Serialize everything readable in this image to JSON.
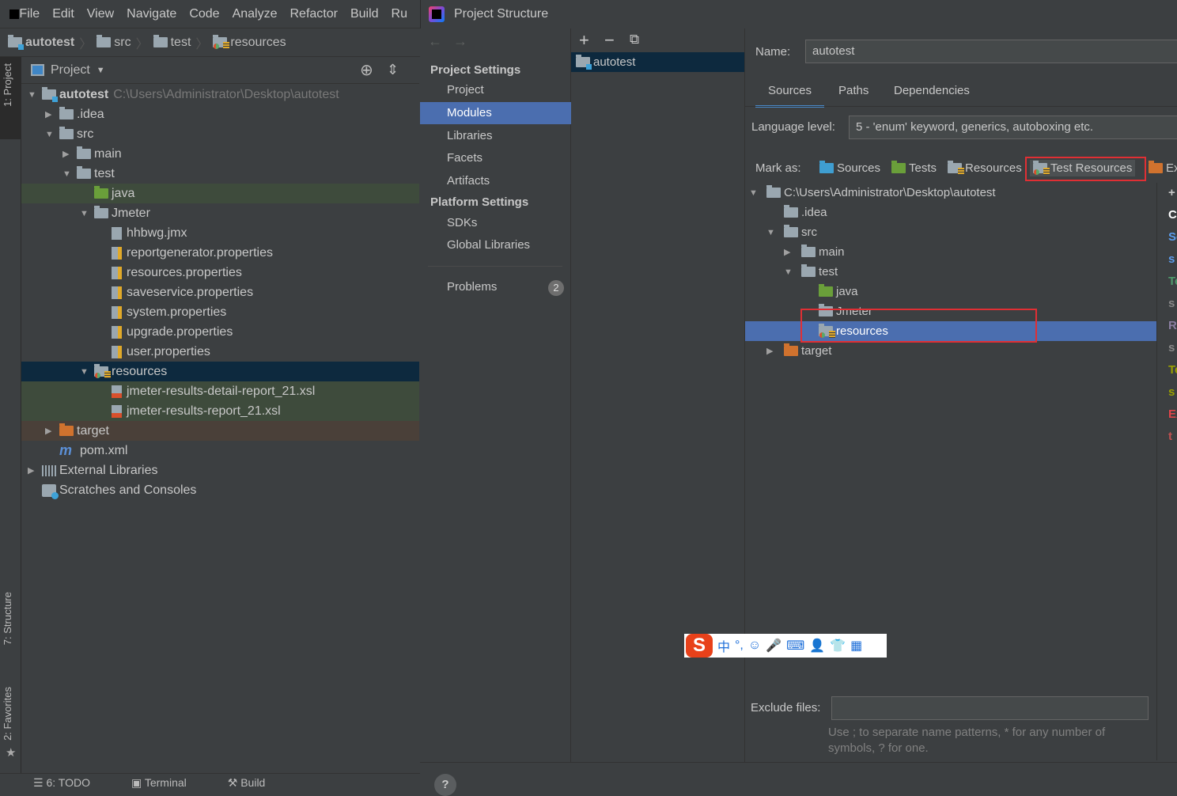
{
  "ide": {
    "menu": [
      "File",
      "Edit",
      "View",
      "Navigate",
      "Code",
      "Analyze",
      "Refactor",
      "Build",
      "Ru"
    ],
    "breadcrumb": [
      "autotest",
      "src",
      "test",
      "resources"
    ],
    "tool_tabs": {
      "project": "1: Project",
      "structure": "7: Structure",
      "favorites": "2: Favorites"
    },
    "project_view": "Project",
    "tree": [
      {
        "label": "autotest",
        "path": "C:\\Users\\Administrator\\Desktop\\autotest",
        "depth": 0,
        "arrow": "down",
        "icon": "folder-module",
        "bold": true
      },
      {
        "label": ".idea",
        "depth": 1,
        "arrow": "right",
        "icon": "folder"
      },
      {
        "label": "src",
        "depth": 1,
        "arrow": "down",
        "icon": "folder"
      },
      {
        "label": "main",
        "depth": 2,
        "arrow": "right",
        "icon": "folder"
      },
      {
        "label": "test",
        "depth": 2,
        "arrow": "down",
        "icon": "folder"
      },
      {
        "label": "java",
        "depth": 3,
        "arrow": "",
        "icon": "folder-green",
        "bg": "#3e4b3c"
      },
      {
        "label": "Jmeter",
        "depth": 3,
        "arrow": "down",
        "icon": "folder"
      },
      {
        "label": "hhbwg.jmx",
        "depth": 4,
        "arrow": "",
        "icon": "file"
      },
      {
        "label": "reportgenerator.properties",
        "depth": 4,
        "arrow": "",
        "icon": "props"
      },
      {
        "label": "resources.properties",
        "depth": 4,
        "arrow": "",
        "icon": "props"
      },
      {
        "label": "saveservice.properties",
        "depth": 4,
        "arrow": "",
        "icon": "props"
      },
      {
        "label": "system.properties",
        "depth": 4,
        "arrow": "",
        "icon": "props"
      },
      {
        "label": "upgrade.properties",
        "depth": 4,
        "arrow": "",
        "icon": "props"
      },
      {
        "label": "user.properties",
        "depth": 4,
        "arrow": "",
        "icon": "props"
      },
      {
        "label": "resources",
        "depth": 3,
        "arrow": "down",
        "icon": "folder-test-resources",
        "bg": "#0d293e"
      },
      {
        "label": "jmeter-results-detail-report_21.xsl",
        "depth": 4,
        "arrow": "",
        "icon": "xsl",
        "bg": "#3e4b3c"
      },
      {
        "label": "jmeter-results-report_21.xsl",
        "depth": 4,
        "arrow": "",
        "icon": "xsl",
        "bg": "#3e4b3c"
      },
      {
        "label": "target",
        "depth": 1,
        "arrow": "right",
        "icon": "folder-orange",
        "bg": "#4a4039"
      },
      {
        "label": "pom.xml",
        "depth": 1,
        "arrow": "",
        "icon": "maven"
      },
      {
        "label": "External Libraries",
        "depth": 0,
        "arrow": "right",
        "icon": "libraries"
      },
      {
        "label": "Scratches and Consoles",
        "depth": 0,
        "arrow": "",
        "icon": "scratches"
      }
    ],
    "status": [
      "6: TODO",
      "Terminal",
      "Build"
    ]
  },
  "dialog": {
    "title": "Project Structure",
    "project_settings": "Project Settings",
    "project_items": [
      "Project",
      "Modules",
      "Libraries",
      "Facets",
      "Artifacts"
    ],
    "selected": "Modules",
    "platform_settings": "Platform Settings",
    "platform_items": [
      "SDKs",
      "Global Libraries"
    ],
    "problems": "Problems",
    "problems_count": "2",
    "module": "autotest",
    "name_label": "Name:",
    "name_value": "autotest",
    "tabs": [
      "Sources",
      "Paths",
      "Dependencies"
    ],
    "language_label": "Language level:",
    "language_value": "5 - 'enum' keyword, generics, autoboxing etc.",
    "mark_as": "Mark as:",
    "mark_buttons": [
      "Sources",
      "Tests",
      "Resources",
      "Test Resources",
      "Ex"
    ],
    "tree": [
      {
        "label": "C:\\Users\\Administrator\\Desktop\\autotest",
        "depth": 0,
        "arrow": "down",
        "icon": "folder"
      },
      {
        "label": ".idea",
        "depth": 1,
        "arrow": "",
        "icon": "folder"
      },
      {
        "label": "src",
        "depth": 1,
        "arrow": "down",
        "icon": "folder"
      },
      {
        "label": "main",
        "depth": 2,
        "arrow": "right",
        "icon": "folder"
      },
      {
        "label": "test",
        "depth": 2,
        "arrow": "down",
        "icon": "folder"
      },
      {
        "label": "java",
        "depth": 3,
        "arrow": "",
        "icon": "folder-green"
      },
      {
        "label": "Jmeter",
        "depth": 3,
        "arrow": "",
        "icon": "folder"
      },
      {
        "label": "resources",
        "depth": 3,
        "arrow": "",
        "icon": "folder-test-resources",
        "selected": true
      },
      {
        "label": "target",
        "depth": 1,
        "arrow": "right",
        "icon": "folder-orange"
      }
    ],
    "roots_panel": [
      {
        "t": "+",
        "c": "#c8c8c8"
      },
      {
        "t": "C:",
        "c": "#ffffff"
      },
      {
        "t": "So",
        "c": "#5c9ded"
      },
      {
        "t": "s",
        "c": "#5c9ded"
      },
      {
        "t": "Te",
        "c": "#4f9a6c"
      },
      {
        "t": "s",
        "c": "#888888"
      },
      {
        "t": "Re",
        "c": "#8a7ea0"
      },
      {
        "t": "s",
        "c": "#888888"
      },
      {
        "t": "Te",
        "c": "#9aa000"
      },
      {
        "t": "s",
        "c": "#9aa000"
      },
      {
        "t": "Ex",
        "c": "#e0454a"
      },
      {
        "t": "t",
        "c": "#c05050"
      }
    ],
    "exclude_label": "Exclude files:",
    "exclude_hint": "Use ; to separate name patterns, * for any number of symbols, ? for one.",
    "help": "?"
  },
  "ime": {
    "items": [
      "中",
      "°,",
      "☺",
      "🎤",
      "⌨",
      "👤",
      "👕",
      "▦"
    ]
  },
  "colors": {
    "selection": "#4b6eaf",
    "highlight": "#e02f34"
  }
}
